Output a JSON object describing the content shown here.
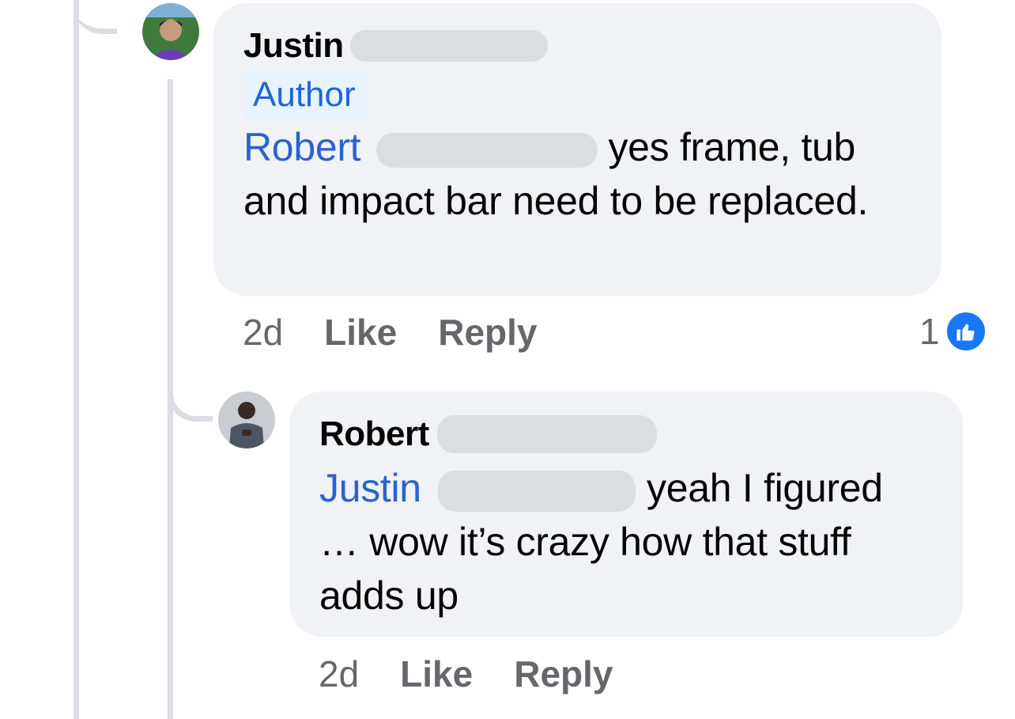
{
  "comments": [
    {
      "author": "Justin",
      "badge": "Author",
      "mention": "Robert",
      "text_after_mention": " yes frame, tub and impact bar need to be replaced.",
      "time": "2d",
      "like_label": "Like",
      "reply_label": "Reply",
      "reaction_count": "1",
      "reaction_icon": "thumbs-up-icon",
      "avatar_icon": "profile-photo"
    },
    {
      "author": "Robert",
      "mention": "Justin",
      "text_after_mention": " yeah I figured … wow it’s crazy how that stuff adds up",
      "time": "2d",
      "like_label": "Like",
      "reply_label": "Reply",
      "avatar_icon": "profile-photo"
    }
  ],
  "colors": {
    "bubble": "#f0f2f5",
    "mention": "#2a63d0",
    "badge_bg": "#e7f3ff",
    "badge_text": "#1f66d4",
    "action_text": "#65676b",
    "like_blue": "#1877f2",
    "thread_line": "#dadde1"
  }
}
